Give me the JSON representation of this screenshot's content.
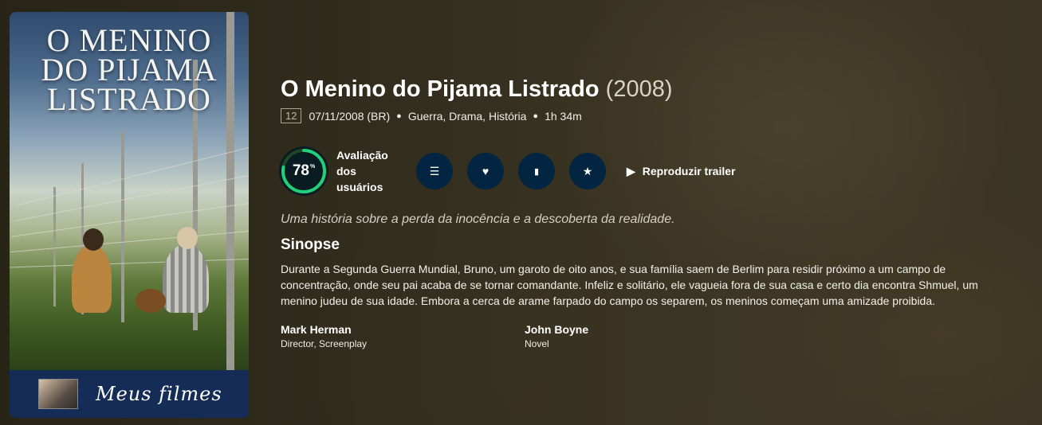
{
  "poster": {
    "title_line1": "O MENINO",
    "title_line2": "DO PIJAMA",
    "title_line3": "LISTRADO",
    "footer_label": "Meus filmes"
  },
  "movie": {
    "title": "O Menino do Pijama Listrado",
    "year": "(2008)",
    "certification": "12",
    "release": "07/11/2008 (BR)",
    "genres": "Guerra, Drama, História",
    "runtime": "1h 34m",
    "tagline": "Uma história sobre a perda da inocência e a descoberta da realidade.",
    "overview_heading": "Sinopse",
    "overview": "Durante a Segunda Guerra Mundial, Bruno, um garoto de oito anos, e sua família saem de Berlim para residir próximo a um campo de concentração, onde seu pai acaba de se tornar comandante. Infeliz e solitário, ele vagueia fora de sua casa e certo dia encontra Shmuel, um menino judeu de sua idade. Embora a cerca de arame farpado do campo os separem, os meninos começam uma amizade proibida."
  },
  "score": {
    "value": "78",
    "unit": "%",
    "fraction": 0.78,
    "label": "Avaliação dos usuários",
    "ring_color": "#21d07a",
    "track_color": "#204529"
  },
  "actions": [
    {
      "name": "add-to-list-button",
      "icon": "list-icon",
      "glyph": "☰"
    },
    {
      "name": "favorite-button",
      "icon": "heart-icon",
      "glyph": "♥"
    },
    {
      "name": "watchlist-button",
      "icon": "bookmark-icon",
      "glyph": "▮"
    },
    {
      "name": "rate-button",
      "icon": "star-icon",
      "glyph": "★"
    }
  ],
  "trailer": {
    "icon": "play-icon",
    "glyph": "▶",
    "label": "Reproduzir trailer"
  },
  "crew": [
    {
      "name": "Mark Herman",
      "role": "Director, Screenplay"
    },
    {
      "name": "John Boyne",
      "role": "Novel"
    }
  ],
  "colors": {
    "button_bg": "#032541",
    "poster_footer_bg": "#152c57"
  }
}
